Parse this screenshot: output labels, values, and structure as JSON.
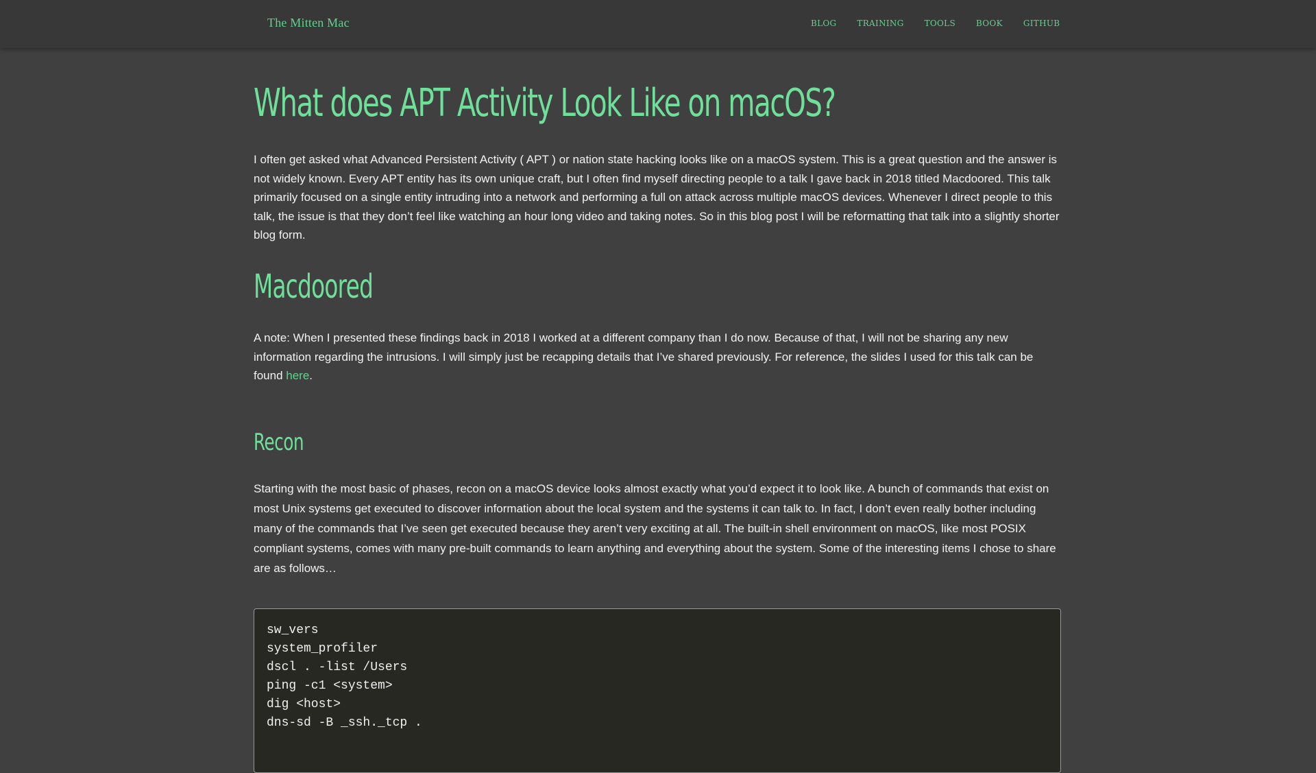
{
  "navbar": {
    "brand": "The Mitten Mac",
    "links": [
      "BLOG",
      "TRAINING",
      "TOOLS",
      "BOOK",
      "GITHUB"
    ]
  },
  "article": {
    "title": "What does APT Activity Look Like on macOS?",
    "intro": "I often get asked what Advanced Persistent Activity ( APT ) or nation state hacking looks like on a macOS system. This is a great question and the answer is not widely known. Every APT entity has its own unique craft, but I often find myself directing people to a talk I gave back in 2018 titled Macdoored. This talk primarily focused on a single entity intruding into a network and performing a full on attack across multiple macOS devices. Whenever I direct people to this talk, the issue is that they don’t feel like watching an hour long video and taking notes. So in this blog post I will be reformatting that talk into a slightly shorter blog form.",
    "section_heading": "Macdoored",
    "note_before_link": "A note: When I presented these findings back in 2018 I worked at a different company than I do now. Because of that, I will not be sharing any new information regarding the intrusions. I will simply just be recapping details that I’ve shared previously. For reference, the slides I used for this talk can be found ",
    "note_link": "here",
    "note_after_link": ".",
    "recon_heading": "Recon",
    "recon_text": "Starting with the most basic of phases, recon on a macOS device looks almost exactly what you’d expect it to look like. A bunch of commands that exist on most Unix systems get executed to discover information about the local system and the systems it can talk to. In fact, I don’t even really bother including many of the commands that I’ve seen get executed because they aren’t very exciting at all. The built-in shell environment on macOS, like most POSIX compliant systems, comes with many pre-built commands to learn anything and everything about the system. Some of the interesting items I chose to share are as follows…",
    "code_lines": [
      "sw_vers",
      "system_profiler",
      "dscl . -list /Users",
      "ping -c1 <system>",
      "dig <host>",
      "dns-sd -B _ssh._tcp ."
    ]
  },
  "colors": {
    "accent": "#5fd38d",
    "background": "#404040",
    "navbar": "#383838",
    "code_background": "#272822"
  }
}
